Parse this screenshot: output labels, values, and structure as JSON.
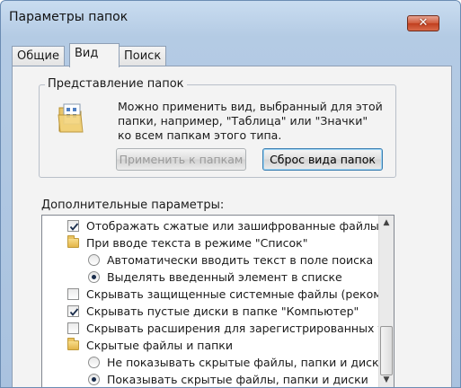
{
  "window": {
    "title": "Параметры папок",
    "close_glyph": "✕"
  },
  "tabs": [
    {
      "label": "Общие",
      "active": false
    },
    {
      "label": "Вид",
      "active": true
    },
    {
      "label": "Поиск",
      "active": false
    }
  ],
  "folder_views": {
    "group_title": "Представление папок",
    "icon": "folder-view-icon",
    "description_lines": [
      "Можно применить вид, выбранный для этой",
      "папки, например, \"Таблица\" или \"Значки\"",
      "ко всем папкам этого типа."
    ],
    "apply_button": "Применить к папкам",
    "reset_button": "Сброс вида папок"
  },
  "advanced": {
    "label": "Дополнительные параметры:",
    "items": [
      {
        "type": "checkbox",
        "checked": true,
        "label": "Отображать сжатые или зашифрованные файлы NTI",
        "indent": 0
      },
      {
        "type": "folder",
        "label": "При вводе текста в режиме \"Список\"",
        "indent": 0
      },
      {
        "type": "radio",
        "checked": false,
        "label": "Автоматически вводить текст в поле поиска",
        "indent": 1
      },
      {
        "type": "radio",
        "checked": true,
        "label": "Выделять введенный элемент в списке",
        "indent": 1
      },
      {
        "type": "checkbox",
        "checked": false,
        "label": "Скрывать защищенные системные файлы (рекомен,",
        "indent": 0
      },
      {
        "type": "checkbox",
        "checked": true,
        "label": "Скрывать пустые диски в папке \"Компьютер\"",
        "indent": 0
      },
      {
        "type": "checkbox",
        "checked": false,
        "label": "Скрывать расширения для зарегистрированных типо",
        "indent": 0
      },
      {
        "type": "folder",
        "label": "Скрытые файлы и папки",
        "indent": 0
      },
      {
        "type": "radio",
        "checked": false,
        "label": "Не показывать скрытые файлы, папки и диски",
        "indent": 1
      },
      {
        "type": "radio",
        "checked": true,
        "label": "Показывать скрытые файлы, папки и диски",
        "indent": 1
      }
    ]
  },
  "scrollbar": {
    "up": "▲",
    "down": "▼"
  },
  "colors": {
    "title_bar": "#b4cbe4",
    "close_button": "#c03e1e",
    "dialog_face": "#f3f3f3",
    "focus_border": "#3c7fb1"
  }
}
